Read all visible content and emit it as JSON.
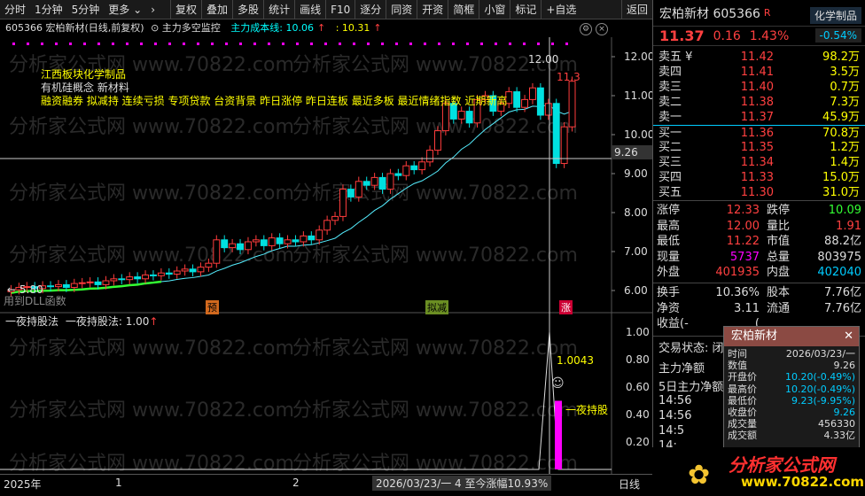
{
  "toolbar": {
    "left": [
      "分时",
      "1分钟",
      "5分钟",
      "更多"
    ],
    "right": [
      "复权",
      "叠加",
      "多股",
      "统计",
      "画线",
      "F10",
      "逐分",
      "同资",
      "开资",
      "简框",
      "小窗",
      "标记",
      "+自选",
      "返回"
    ]
  },
  "chart_header": {
    "code_name": "605366 宏柏新材(日线,前复权)",
    "indicator": "主力多空监控",
    "cost_label": "主力成本线: 10.06",
    "cost_extra": ": 10.31"
  },
  "annotations": {
    "sector": "江西板块",
    "sector2": "化学制品",
    "concept": "有机硅概念 新材料",
    "tags": "融资融券 拟减持 连续亏损 专项贷款 台资背景 昨日涨停 昨日连板 最近多板 最近情绪指数 近期新高",
    "high_label": "12.00",
    "price_label": "11.3",
    "low_label": "5.80",
    "bottom_text": "用到DLL函数",
    "marker_yu": "预",
    "marker_jian": "拟减",
    "marker_zhang": "涨",
    "h_line_value": "9.26",
    "watermark": "分析家公式网 www.70822.com"
  },
  "y_axis_upper": [
    "12.00",
    "11.00",
    "10.00",
    "9.00",
    "8.00",
    "7.00",
    "6.00"
  ],
  "y_axis_lower": [
    "1.00",
    "0.80",
    "0.60",
    "0.40",
    "0.20"
  ],
  "lower": {
    "title": "一夜持股法",
    "value_label": "一夜持股法: 1.00",
    "spike_label": "1.0043",
    "bar_label": "一夜持股"
  },
  "bottom": {
    "year": "2025年",
    "m1": "1",
    "m2": "2",
    "info": "2026/03/23/一 4 至今涨幅10.93%",
    "period": "日线"
  },
  "sidebar": {
    "name_code": "宏柏新材 605366",
    "r_badge": "R",
    "industry": "化学制品",
    "industry_pct": "-0.54%",
    "price": "11.37",
    "change": "0.16",
    "pct": "1.43%",
    "orderbook": [
      {
        "l": "卖五 ¥",
        "p": "11.42",
        "v": "98.2万"
      },
      {
        "l": "卖四",
        "p": "11.41",
        "v": "3.5万"
      },
      {
        "l": "卖三",
        "p": "11.40",
        "v": "0.7万"
      },
      {
        "l": "卖二",
        "p": "11.38",
        "v": "7.3万"
      },
      {
        "l": "卖一",
        "p": "11.37",
        "v": "45.9万"
      },
      {
        "l": "买一",
        "p": "11.36",
        "v": "70.8万"
      },
      {
        "l": "买二",
        "p": "11.35",
        "v": "1.2万"
      },
      {
        "l": "买三",
        "p": "11.34",
        "v": "1.4万"
      },
      {
        "l": "买四",
        "p": "11.33",
        "v": "15.0万"
      },
      {
        "l": "买五",
        "p": "11.30",
        "v": "31.0万"
      }
    ],
    "stats": [
      {
        "l": "涨停",
        "v": "12.33",
        "vc": "#ff4040",
        "l2": "跌停",
        "v2": "10.09",
        "v2c": "#3f3"
      },
      {
        "l": "最高",
        "v": "12.00",
        "vc": "#ff4040",
        "l2": "量比",
        "v2": "1.91",
        "v2c": "#ff4040"
      },
      {
        "l": "最低",
        "v": "11.22",
        "vc": "#ff4040",
        "l2": "市值",
        "v2": "88.2亿",
        "v2c": "#ddd"
      },
      {
        "l": "现量",
        "v": "5737",
        "vc": "#f0f",
        "l2": "总量",
        "v2": "803975",
        "v2c": "#ddd"
      },
      {
        "l": "外盘",
        "v": "401935",
        "vc": "#ff4040",
        "l2": "内盘",
        "v2": "402040",
        "v2c": "#0cf"
      }
    ],
    "stats2": [
      {
        "l": "换手",
        "v": "10.36%",
        "l2": "股本",
        "v2": "7.76亿"
      },
      {
        "l": "净资",
        "v": "3.11",
        "l2": "流通",
        "v2": "7.76亿"
      },
      {
        "l": "收益(-",
        "v": "(",
        "l2": "",
        "v2": ""
      }
    ],
    "trade_state": "交易状态: 闭",
    "flow1": "主力净额",
    "flow2": "5日主力净额",
    "ticks": [
      "14:56",
      "14:56",
      "14:5",
      "14:",
      "14:"
    ]
  },
  "tooltip": {
    "title": "宏柏新材",
    "rows": [
      {
        "k": "时间",
        "v": "2026/03/23/一",
        "c": "#ddd"
      },
      {
        "k": "数值",
        "v": "9.26",
        "c": "#ddd"
      },
      {
        "k": "开盘价",
        "v": "10.20(-0.49%)",
        "c": "#0cf"
      },
      {
        "k": "最高价",
        "v": "10.20(-0.49%)",
        "c": "#0cf"
      },
      {
        "k": "最低价",
        "v": "9.23(-9.95%)",
        "c": "#0cf"
      },
      {
        "k": "收盘价",
        "v": "9.26",
        "c": "#0cf"
      },
      {
        "k": "成交量",
        "v": "456330",
        "c": "#ddd"
      },
      {
        "k": "成交额",
        "v": "4.33亿",
        "c": "#ddd"
      }
    ]
  },
  "logo": {
    "line1": "分析家公式网",
    "line2": "www.70822.com"
  },
  "chart_data": {
    "type": "candlestick",
    "ylim": [
      5.5,
      12.5
    ],
    "closes": [
      6.02,
      6.08,
      6.1,
      6.05,
      6.12,
      6.1,
      6.15,
      6.08,
      6.18,
      6.2,
      6.22,
      6.15,
      6.25,
      6.3,
      6.28,
      6.35,
      6.3,
      6.4,
      6.38,
      6.45,
      6.42,
      6.5,
      6.55,
      6.48,
      6.6,
      6.7,
      7.3,
      7.1,
      7.2,
      7.05,
      7.25,
      7.3,
      7.15,
      7.35,
      7.2,
      7.3,
      7.25,
      7.4,
      7.3,
      7.55,
      7.8,
      7.9,
      8.6,
      8.4,
      8.8,
      8.7,
      8.9,
      8.6,
      9.0,
      8.95,
      9.2,
      9.1,
      9.3,
      9.6,
      10.1,
      10.8,
      10.4,
      10.6,
      10.3,
      10.9,
      11.0,
      10.6,
      10.8,
      11.1,
      10.7,
      10.9,
      11.2,
      10.5,
      10.8,
      9.26,
      10.2,
      11.37
    ],
    "lower_value": 1.0
  }
}
